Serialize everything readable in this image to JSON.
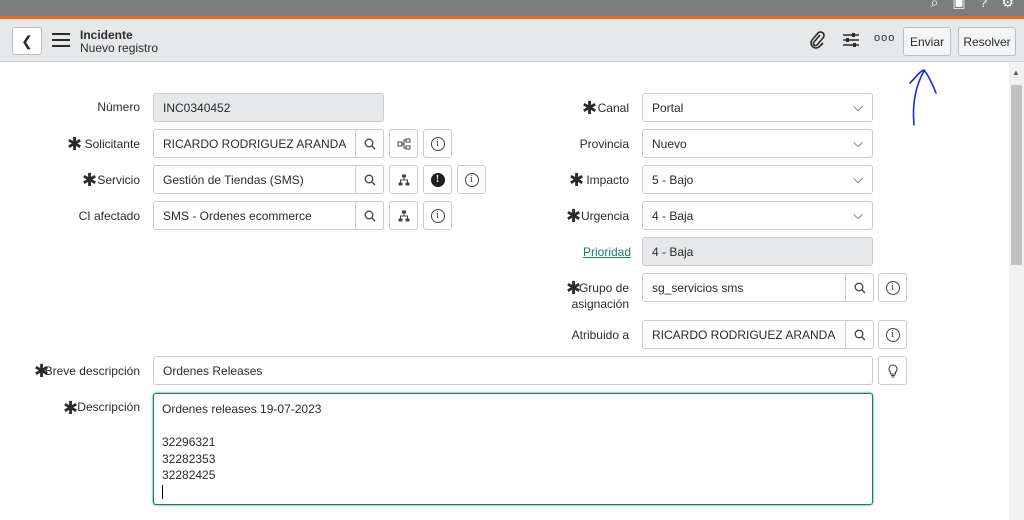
{
  "header": {
    "title": "Incidente",
    "subtitle": "Nuevo registro",
    "buttons": {
      "submit": "Enviar",
      "resolve": "Resolver"
    },
    "icons": [
      "back-icon",
      "menu-icon",
      "paperclip-icon",
      "sliders-icon",
      "more-icon"
    ]
  },
  "form": {
    "numero": {
      "label": "Número",
      "value": "INC0340452"
    },
    "solicitante": {
      "label": "Solicitante",
      "value": "RICARDO RODRIGUEZ ARANDA"
    },
    "servicio": {
      "label": "Servicio",
      "value": "Gestión de Tiendas (SMS)"
    },
    "ci": {
      "label": "CI afectado",
      "value": "SMS - Ordenes ecommerce"
    },
    "canal": {
      "label": "Canal",
      "value": "Portal"
    },
    "provincia": {
      "label": "Provincia",
      "value": "Nuevo"
    },
    "impacto": {
      "label": "Impacto",
      "value": "5 - Bajo"
    },
    "urgencia": {
      "label": "Urgencia",
      "value": "4 - Baja"
    },
    "prioridad": {
      "label": "Prioridad",
      "value": "4 - Baja"
    },
    "grupo": {
      "label_1": "Grupo de",
      "label_2": "asignación",
      "value": "sg_servicios sms"
    },
    "atribuido": {
      "label": "Atribuido a",
      "value": "RICARDO RODRIGUEZ ARANDA"
    },
    "breve": {
      "label": "Breve descripción",
      "value": "Ordenes Releases"
    },
    "descripcion": {
      "label": "Descripción",
      "lines": [
        "Ordenes releases 19-07-2023",
        "",
        "32296321",
        "32282353",
        "32282425"
      ]
    }
  },
  "colors": {
    "accent": "#f26a21",
    "focus": "#1a7d6e",
    "annotation": "#1a2bd6"
  }
}
